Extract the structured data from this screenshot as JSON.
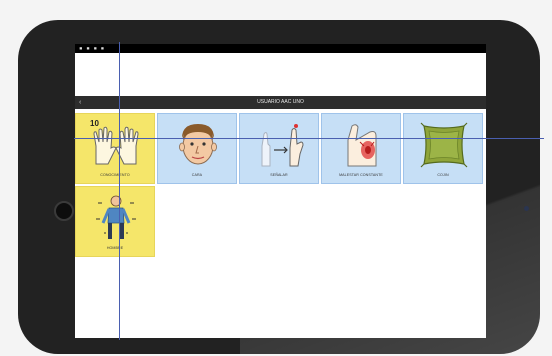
{
  "status_bar": {
    "text": "▪ ▪ ▪ ▪"
  },
  "title_bar": {
    "title": "USUARIO AAC UNO",
    "back": "‹"
  },
  "cards": [
    {
      "label": "CONOCIMIENTO",
      "color": "yellow",
      "number": "10",
      "icon": "hands-icon"
    },
    {
      "label": "CARA",
      "color": "blue",
      "icon": "face-icon"
    },
    {
      "label": "SEÑALAR",
      "color": "blue",
      "icon": "pointing-hand-icon"
    },
    {
      "label": "MALESTAR CONSTANTE",
      "color": "blue",
      "icon": "pain-arm-icon"
    },
    {
      "label": "COJIN",
      "color": "blue",
      "icon": "cushion-icon"
    },
    {
      "label": "HOMBRE",
      "color": "yellow",
      "icon": "person-icon"
    }
  ],
  "colors": {
    "yellow": "#f5e66a",
    "blue": "#c6dff6",
    "overlay_line": "#4a5fb0"
  }
}
